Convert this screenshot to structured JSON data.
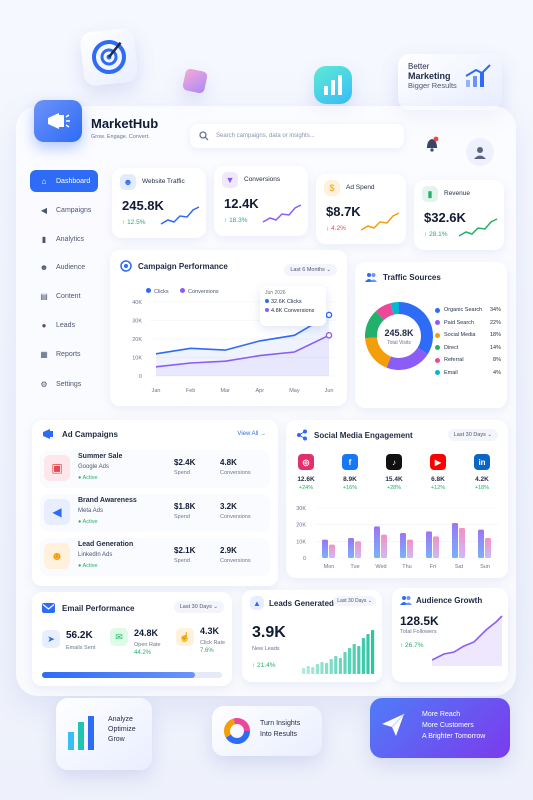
{
  "floating": {
    "better_marketing": [
      "Better",
      "Marketing",
      "Bigger Results"
    ],
    "analyze": [
      "Analyze",
      "Optimize",
      "Grow"
    ],
    "insights": [
      "Turn Insights",
      "Into Results"
    ],
    "reach": [
      "More Reach",
      "More Customers",
      "A Brighter Tomorrow"
    ]
  },
  "brand": {
    "name": "MarketHub",
    "tagline": "Grow. Engage. Convert."
  },
  "search": {
    "placeholder": "Search campaigns, data or insights..."
  },
  "sidebar": {
    "items": [
      {
        "label": "Dashboard",
        "icon": "home-icon",
        "active": true
      },
      {
        "label": "Campaigns",
        "icon": "megaphone-icon"
      },
      {
        "label": "Analytics",
        "icon": "bar-chart-icon"
      },
      {
        "label": "Audience",
        "icon": "users-icon"
      },
      {
        "label": "Content",
        "icon": "document-icon"
      },
      {
        "label": "Leads",
        "icon": "user-icon"
      },
      {
        "label": "Reports",
        "icon": "report-icon"
      },
      {
        "label": "Settings",
        "icon": "gear-icon"
      }
    ]
  },
  "kpis": [
    {
      "label": "Website Traffic",
      "value": "245.8K",
      "delta": "12.5%",
      "dir": "up",
      "color": "#2e6bf6"
    },
    {
      "label": "Conversions",
      "value": "12.4K",
      "delta": "18.3%",
      "dir": "up",
      "color": "#8b5cf6"
    },
    {
      "label": "Ad Spend",
      "value": "$8.7K",
      "delta": "4.2%",
      "dir": "down",
      "color": "#f59e0b"
    },
    {
      "label": "Revenue",
      "value": "$32.6K",
      "delta": "28.1%",
      "dir": "up",
      "color": "#22b06a"
    }
  ],
  "campaign_performance": {
    "title": "Campaign Performance",
    "range": "Last 6 Months",
    "legend": [
      "Clicks",
      "Conversions"
    ],
    "tooltip": {
      "month": "Jun 2026",
      "clicks": "32.6K Clicks",
      "conversions": "4.8K Conversions"
    }
  },
  "traffic_sources": {
    "title": "Traffic Sources",
    "center_value": "245.8K",
    "center_label": "Total Visits",
    "items": [
      {
        "label": "Organic Search",
        "pct": "34%",
        "color": "#2e6bf6"
      },
      {
        "label": "Paid Search",
        "pct": "22%",
        "color": "#8b5cf6"
      },
      {
        "label": "Social Media",
        "pct": "18%",
        "color": "#f59e0b"
      },
      {
        "label": "Direct",
        "pct": "14%",
        "color": "#22b06a"
      },
      {
        "label": "Referral",
        "pct": "8%",
        "color": "#ec4899"
      },
      {
        "label": "Email",
        "pct": "4%",
        "color": "#06b6d4"
      }
    ]
  },
  "ad_campaigns": {
    "title": "Ad Campaigns",
    "view_all": "View All →",
    "items": [
      {
        "name": "Summer Sale",
        "platform": "Google Ads",
        "status": "Active",
        "spend": "$2.4K",
        "spend_label": "Spend",
        "conv": "4.8K",
        "conv_label": "Conversions",
        "color": "#e5484d",
        "bg": "#fde7ea"
      },
      {
        "name": "Brand Awareness",
        "platform": "Meta Ads",
        "status": "Active",
        "spend": "$1.8K",
        "spend_label": "Spend",
        "conv": "3.2K",
        "conv_label": "Conversions",
        "color": "#2e6bf6",
        "bg": "#e6eeff"
      },
      {
        "name": "Lead Generation",
        "platform": "LinkedIn Ads",
        "status": "Active",
        "spend": "$2.1K",
        "spend_label": "Spend",
        "conv": "2.9K",
        "conv_label": "Conversions",
        "color": "#f59e0b",
        "bg": "#fff1dc"
      }
    ]
  },
  "social": {
    "title": "Social Media Engagement",
    "range": "Last 30 Days",
    "platforms": [
      {
        "name": "Instagram",
        "value": "12.6K",
        "delta": "+24%",
        "color": "#e1306c",
        "glyph": "◎"
      },
      {
        "name": "Facebook",
        "value": "8.9K",
        "delta": "+16%",
        "color": "#1877f2",
        "glyph": "f"
      },
      {
        "name": "TikTok",
        "value": "15.4K",
        "delta": "+28%",
        "color": "#111111",
        "glyph": "♪"
      },
      {
        "name": "YouTube",
        "value": "6.8K",
        "delta": "+12%",
        "color": "#ff0000",
        "glyph": "▶"
      },
      {
        "name": "LinkedIn",
        "value": "4.2K",
        "delta": "+18%",
        "color": "#0a66c2",
        "glyph": "in"
      }
    ]
  },
  "email": {
    "title": "Email Performance",
    "range": "Last 30 Days",
    "sent": "56.2K",
    "sent_label": "Emails Sent",
    "open": "24.8K",
    "open_label": "Open Rate",
    "open_pct": "44.2%",
    "click": "4.3K",
    "click_label": "Click Rate",
    "click_pct": "7.6%",
    "progress": 0.85
  },
  "leads": {
    "title": "Leads Generated",
    "range": "Last 30 Days",
    "value": "3.9K",
    "label": "New Leads",
    "delta": "↑ 21.4%"
  },
  "audience": {
    "title": "Audience Growth",
    "value": "128.5K",
    "label": "Total Followers",
    "delta": "↑ 26.7%"
  },
  "chart_data": [
    {
      "type": "line",
      "title": "Campaign Performance",
      "categories": [
        "Jan",
        "Feb",
        "Mar",
        "Apr",
        "May",
        "Jun"
      ],
      "yticks": [
        "40K",
        "30K",
        "20K",
        "10K",
        "0"
      ],
      "ylim": [
        0,
        40
      ],
      "series": [
        {
          "name": "Clicks",
          "color": "#2e6bf6",
          "values": [
            12,
            15,
            14,
            19,
            22,
            33
          ]
        },
        {
          "name": "Conversions",
          "color": "#8b5cf6",
          "values": [
            5,
            7,
            8,
            11,
            13,
            22
          ]
        }
      ]
    },
    {
      "type": "pie",
      "title": "Traffic Sources",
      "categories": [
        "Organic Search",
        "Paid Search",
        "Social Media",
        "Direct",
        "Referral",
        "Email"
      ],
      "values": [
        34,
        22,
        18,
        14,
        8,
        4
      ]
    },
    {
      "type": "bar",
      "title": "Social Media Engagement",
      "categories": [
        "Mon",
        "Tue",
        "Wed",
        "Thu",
        "Fri",
        "Sat",
        "Sun"
      ],
      "yticks": [
        "30K",
        "20K",
        "10K",
        "0"
      ],
      "ylim": [
        0,
        30
      ],
      "series": [
        {
          "values": [
            11,
            12,
            19,
            15,
            16,
            21,
            17
          ]
        },
        {
          "values": [
            8,
            10,
            14,
            11,
            13,
            18,
            12
          ]
        }
      ]
    }
  ]
}
